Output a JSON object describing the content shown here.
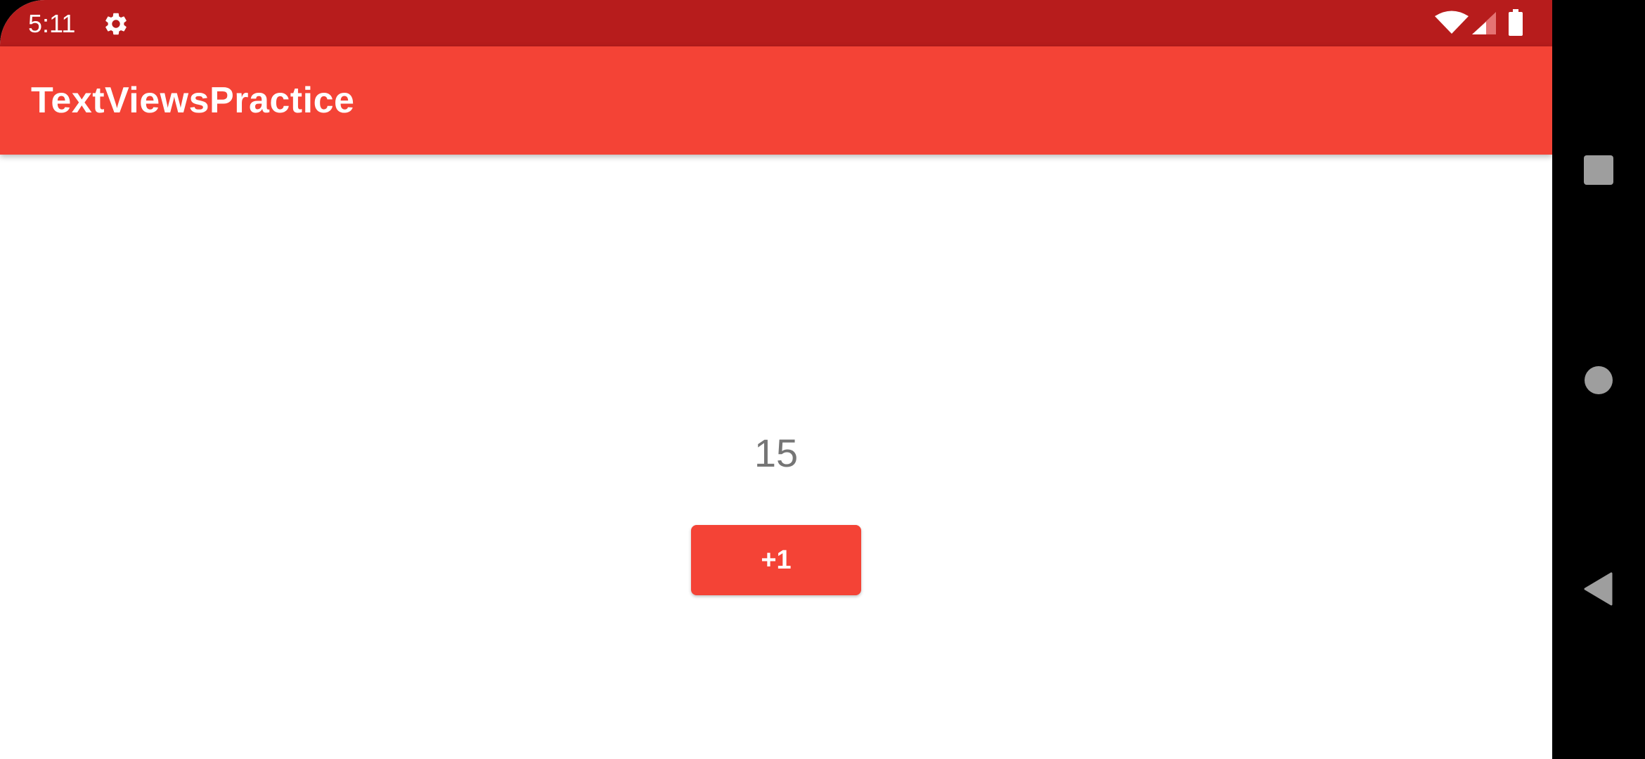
{
  "status_bar": {
    "time": "5:11",
    "icons": [
      "settings-gear-icon",
      "wifi-icon",
      "cell-signal-icon",
      "battery-icon"
    ]
  },
  "app_bar": {
    "title": "TextViewsPractice"
  },
  "main": {
    "counter_value": "15",
    "increment_button_label": "+1"
  },
  "nav_bar": {
    "icons": [
      "recents-square-icon",
      "home-circle-icon",
      "back-triangle-icon"
    ]
  },
  "colors": {
    "status_bar": "#b71c1c",
    "primary": "#f44336",
    "counter_text": "#757575",
    "nav_icons": "#9e9e9e"
  }
}
